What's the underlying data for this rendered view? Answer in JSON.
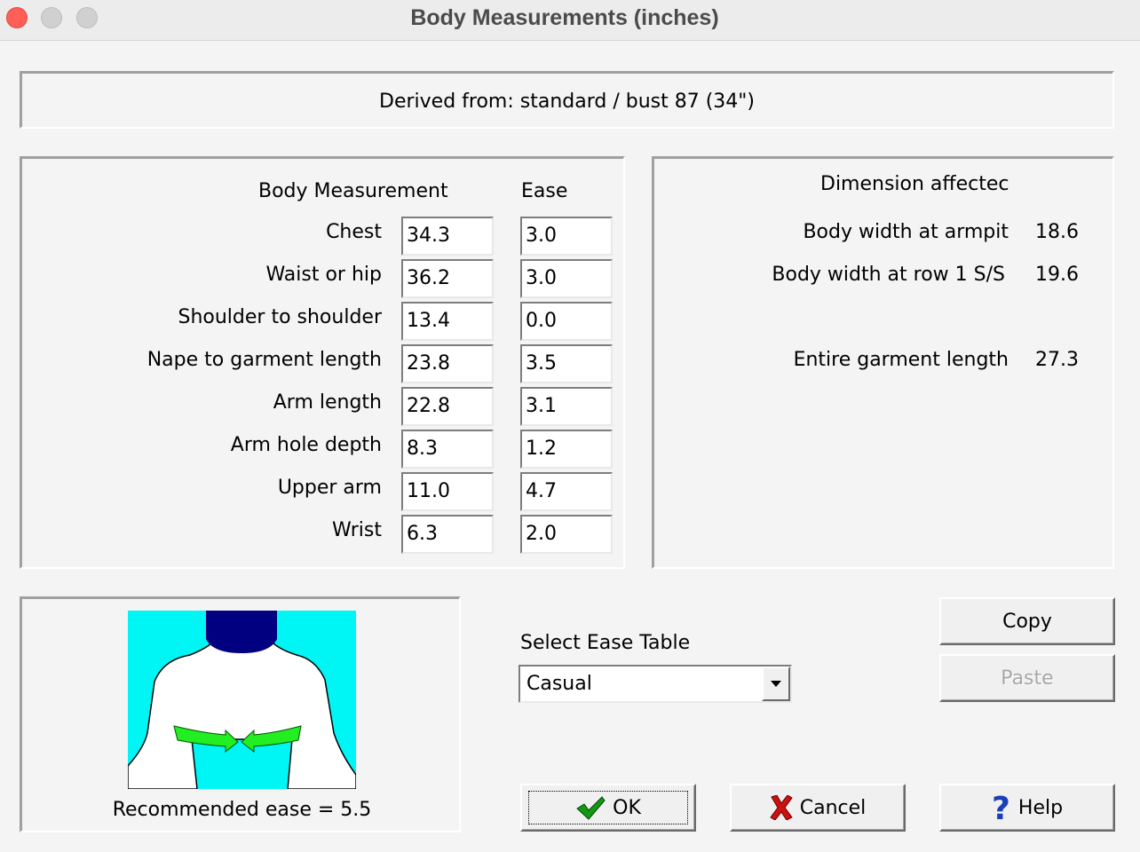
{
  "window": {
    "title": "Body Measurements (inches)"
  },
  "derived": {
    "text": "Derived from:  standard / bust  87 (34\")"
  },
  "measurements": {
    "header_body": "Body Measurement",
    "header_ease": "Ease",
    "rows": [
      {
        "label": "Chest",
        "value": "34.3",
        "ease": "3.0"
      },
      {
        "label": "Waist or hip",
        "value": "36.2",
        "ease": "3.0"
      },
      {
        "label": "Shoulder to shoulder",
        "value": "13.4",
        "ease": "0.0"
      },
      {
        "label": "Nape to garment length",
        "value": "23.8",
        "ease": "3.5"
      },
      {
        "label": "Arm length",
        "value": "22.8",
        "ease": "3.1"
      },
      {
        "label": "Arm hole depth",
        "value": "8.3",
        "ease": "1.2"
      },
      {
        "label": "Upper arm",
        "value": "11.0",
        "ease": "4.7"
      },
      {
        "label": "Wrist",
        "value": "6.3",
        "ease": "2.0"
      }
    ]
  },
  "dimensions": {
    "header": "Dimension affectec",
    "rows": [
      {
        "label": "Body width at armpit",
        "value": "18.6"
      },
      {
        "label": "Body width at row 1 S/S",
        "value": "19.6"
      },
      {
        "label": "Entire garment length",
        "value": "27.3"
      }
    ]
  },
  "illustration": {
    "caption": "Recommended ease = 5.5"
  },
  "ease_table": {
    "label": "Select Ease Table",
    "selected": "Casual"
  },
  "buttons": {
    "copy": "Copy",
    "paste": "Paste",
    "ok": "OK",
    "cancel": "Cancel",
    "help": "Help"
  },
  "colors": {
    "illustration_bg": "#00f5f5",
    "head": "#000080",
    "arrow": "#22ee22",
    "cancel_x": "#cc1111",
    "ok_check": "#119911",
    "help_icon": "#1a3fb8"
  }
}
